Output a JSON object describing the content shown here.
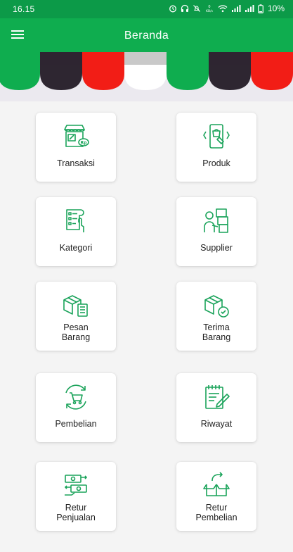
{
  "status_bar": {
    "time": "16.15",
    "battery": "10%"
  },
  "app_bar": {
    "title": "Beranda"
  },
  "menu": [
    {
      "id": "transaksi",
      "label": "Transaksi",
      "icon": "shop-rp-icon"
    },
    {
      "id": "produk",
      "label": "Produk",
      "icon": "phone-shopping-icon"
    },
    {
      "id": "kategori",
      "label": "Kategori",
      "icon": "checklist-hand-icon"
    },
    {
      "id": "supplier",
      "label": "Supplier",
      "icon": "delivery-person-icon"
    },
    {
      "id": "pesan-barang",
      "label": "Pesan\nBarang",
      "icon": "box-checklist-icon"
    },
    {
      "id": "terima-barang",
      "label": "Terima\nBarang",
      "icon": "box-check-icon"
    },
    {
      "id": "pembelian",
      "label": "Pembelian",
      "icon": "cart-refresh-icon"
    },
    {
      "id": "riwayat",
      "label": "Riwayat",
      "icon": "notepad-pen-icon"
    },
    {
      "id": "retur-penjualan",
      "label": "Retur\nPenjualan",
      "icon": "money-return-icon"
    },
    {
      "id": "retur-pembelian",
      "label": "Retur\nPembelian",
      "icon": "open-box-return-icon"
    }
  ],
  "colors": {
    "primary": "#0fad4f",
    "status_bar": "#0c9a48",
    "icon_green": "#1aa35a",
    "awning_green": "#0fad4f",
    "awning_dark": "#2e2631",
    "awning_red": "#f21d16",
    "awning_white": "#ffffff"
  }
}
